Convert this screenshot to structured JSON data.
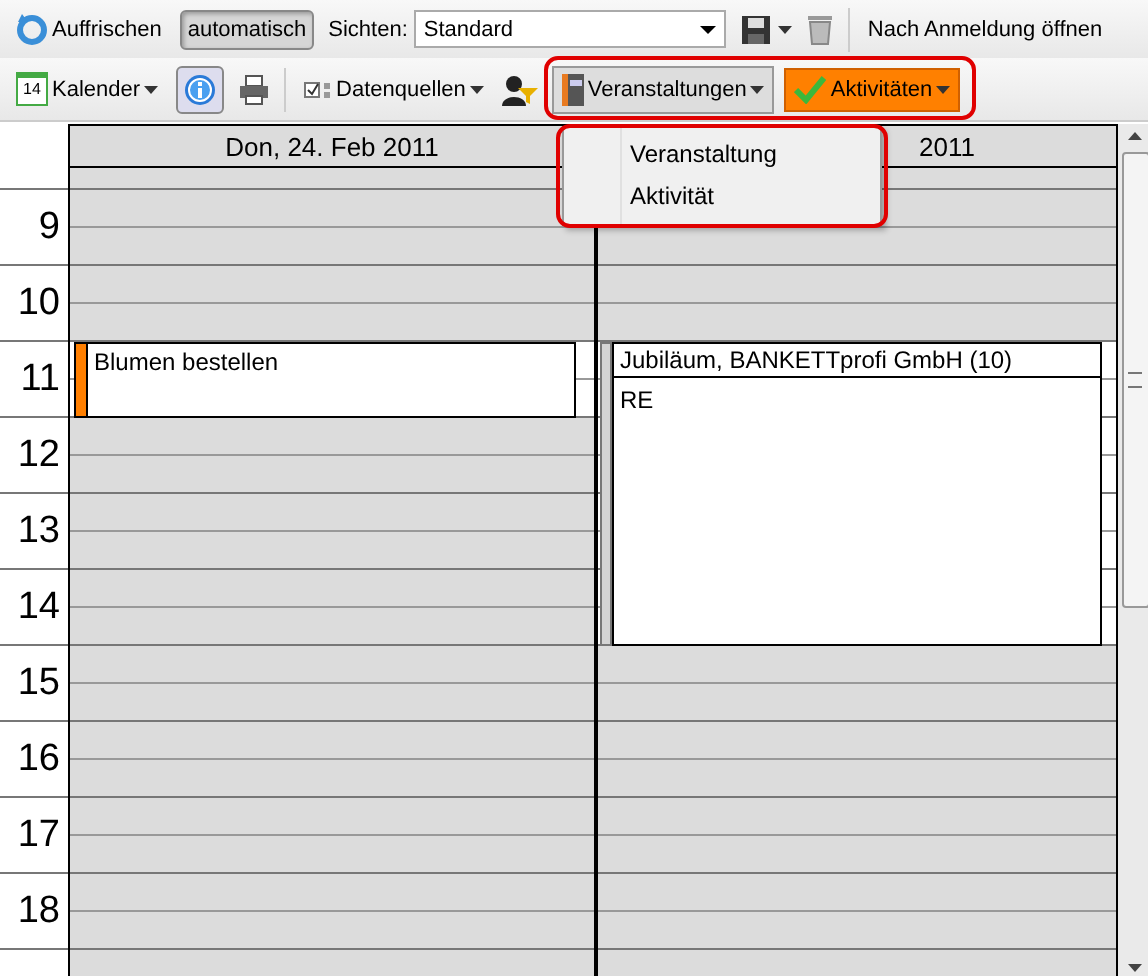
{
  "toolbar_top": {
    "refresh": "Auffrischen",
    "auto_button": {
      "label": "automatisch",
      "pressed": true
    },
    "views_label": "Sichten:",
    "views_value": "Standard",
    "open_after_login": "Nach Anmeldung öffnen"
  },
  "toolbar_second": {
    "calendar": {
      "label": "Kalender",
      "day": "14"
    },
    "info_button": {
      "pressed": true
    },
    "data_sources": "Datenquellen",
    "events_button": "Veranstaltungen",
    "activities_button": "Aktivitäten"
  },
  "hours": [
    "9",
    "10",
    "11",
    "12",
    "13",
    "14",
    "15",
    "16",
    "17",
    "18"
  ],
  "days": [
    {
      "header": "Don, 24. Feb 2011",
      "slots": [
        {
          "busy": false
        },
        {
          "busy": false
        },
        {
          "busy": true
        },
        {
          "busy": false
        },
        {
          "busy": false
        },
        {
          "busy": false
        },
        {
          "busy": false
        },
        {
          "busy": false
        },
        {
          "busy": false
        },
        {
          "busy": false
        }
      ],
      "events": [
        {
          "kind": "task",
          "title": "Blumen bestellen",
          "color": "#ff7f00"
        }
      ]
    },
    {
      "header": "2011",
      "slots": [
        {
          "busy": false
        },
        {
          "busy": false
        },
        {
          "busy": true
        },
        {
          "busy": true
        },
        {
          "busy": true
        },
        {
          "busy": true
        },
        {
          "busy": false
        },
        {
          "busy": false
        },
        {
          "busy": false
        },
        {
          "busy": false
        }
      ],
      "events": [
        {
          "kind": "event",
          "title": "Jubiläum, BANKETTprofi GmbH (10)",
          "body": "RE",
          "color": "#d4d4d4"
        }
      ]
    }
  ],
  "menu": {
    "items": [
      {
        "label": "Veranstaltung"
      },
      {
        "label": "Aktivität"
      }
    ]
  }
}
